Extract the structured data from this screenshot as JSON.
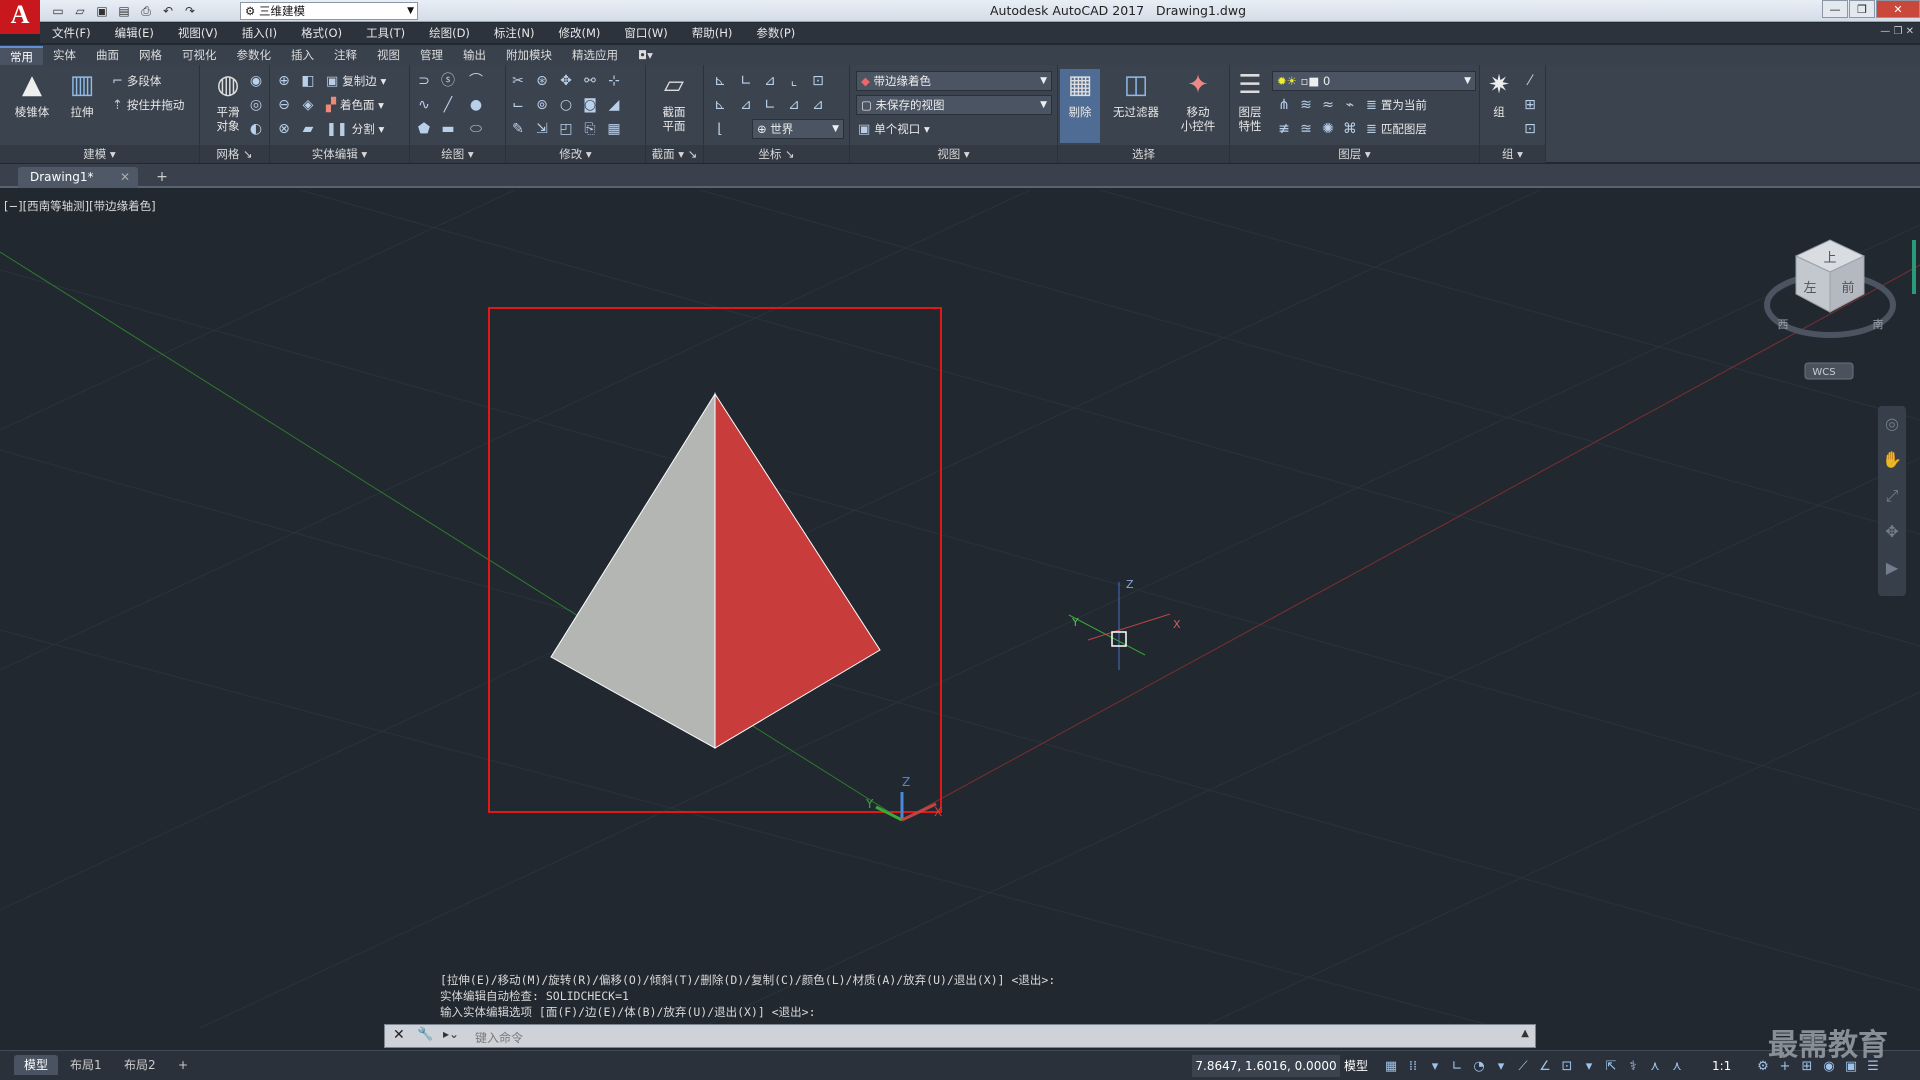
{
  "app": {
    "title": "Autodesk AutoCAD 2017",
    "file": "Drawing1.dwg",
    "logo": "A"
  },
  "qat": {
    "workspace": "三维建模",
    "icons": [
      "new-icon",
      "open-icon",
      "save-icon",
      "saveas-icon",
      "print-icon",
      "undo-icon",
      "redo-icon"
    ]
  },
  "menu": [
    "文件(F)",
    "编辑(E)",
    "视图(V)",
    "插入(I)",
    "格式(O)",
    "工具(T)",
    "绘图(D)",
    "标注(N)",
    "修改(M)",
    "窗口(W)",
    "帮助(H)",
    "参数(P)"
  ],
  "ribbon_tabs": [
    "常用",
    "实体",
    "曲面",
    "网格",
    "可视化",
    "参数化",
    "插入",
    "注释",
    "视图",
    "管理",
    "输出",
    "附加模块",
    "精选应用"
  ],
  "ribbon": {
    "model_panel": {
      "title": "建模",
      "pyramid": "棱锥体",
      "extrude": "拉伸",
      "polysolid": "多段体",
      "presspull": "按住并拖动"
    },
    "mesh_panel": {
      "title": "网格",
      "smooth": "平滑",
      "smooth2": "对象"
    },
    "solidedit_panel": {
      "title": "实体编辑",
      "copy_edge": "复制边",
      "color_face": "着色面",
      "separate": "分割"
    },
    "draw_panel": {
      "title": "绘图"
    },
    "modify_panel": {
      "title": "修改"
    },
    "section_panel": {
      "title": "截面",
      "plane": "截面",
      "plane2": "平面"
    },
    "coord_panel": {
      "title": "坐标",
      "world": "世界"
    },
    "view_panel": {
      "title": "视图",
      "visual_style": "带边缘着色",
      "saved_view": "未保存的视图",
      "viewport": "单个视口"
    },
    "select_panel": {
      "title": "选择",
      "cull": "剔除",
      "nofilter": "无过滤器",
      "gizmo": "移动",
      "gizmo2": "小控件"
    },
    "layers_panel": {
      "title": "图层",
      "props": "图层",
      "props2": "特性",
      "layer_value": "0",
      "set_current": "置为当前",
      "match_layer": "匹配图层"
    },
    "groups_panel": {
      "title": "组",
      "group": "组"
    }
  },
  "doc_tab": "Drawing1*",
  "viewport_label": "[−][西南等轴测][带边缘着色]",
  "viewcube": {
    "top": "上",
    "left": "左",
    "front": "前",
    "west": "西",
    "south": "南",
    "wcs": "WCS"
  },
  "ucs": {
    "x": "X",
    "y": "Y",
    "z": "Z"
  },
  "command_history": [
    "[拉伸(E)/移动(M)/旋转(R)/偏移(O)/倾斜(T)/删除(D)/复制(C)/颜色(L)/材质(A)/放弃(U)/退出(X)] <退出>:",
    "实体编辑自动检查:  SOLIDCHECK=1",
    "输入实体编辑选项 [面(F)/边(E)/体(B)/放弃(U)/退出(X)] <退出>:"
  ],
  "command_placeholder": "键入命令",
  "layout_tabs": [
    "模型",
    "布局1",
    "布局2"
  ],
  "status": {
    "coords": "7.8647, 1.6016, 0.0000",
    "model": "模型",
    "scale": "1:1"
  },
  "colors": {
    "face_left": "#b4b6b4",
    "face_right": "#c83c3c",
    "highlight": "#e01818",
    "background": "#212830"
  },
  "watermark": "最需教育"
}
